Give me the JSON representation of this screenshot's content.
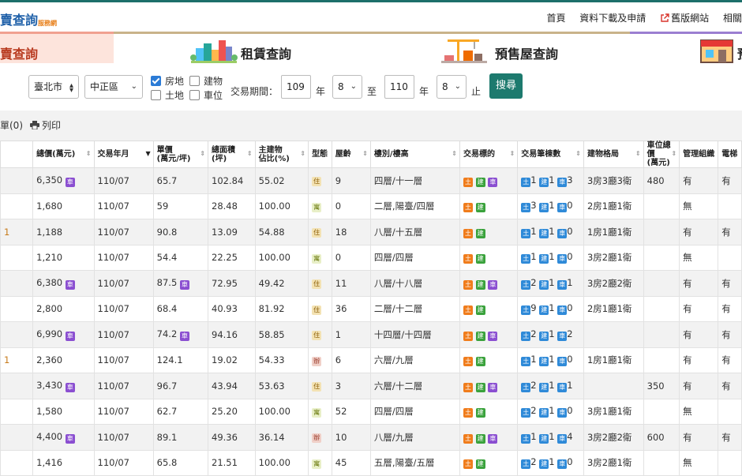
{
  "header": {
    "logo_part1": "賣查詢",
    "logo_part2": "服務網",
    "nav": [
      "首頁",
      "資料下載及申請",
      "舊版網站",
      "相關"
    ]
  },
  "tabs": [
    {
      "label": "賣查詢",
      "active": true
    },
    {
      "label": "租賃查詢",
      "active": false
    },
    {
      "label": "預售屋查詢",
      "active": false
    },
    {
      "label": "預",
      "active": false
    }
  ],
  "search": {
    "city": "臺北市",
    "district": "中正區",
    "checkboxes": [
      {
        "label": "房地",
        "checked": true
      },
      {
        "label": "建物",
        "checked": false
      },
      {
        "label": "土地",
        "checked": false
      },
      {
        "label": "車位",
        "checked": false
      }
    ],
    "period_label": "交易期間：",
    "start_year": "109",
    "year_unit": "年",
    "start_month": "8",
    "to_label": "至",
    "end_year": "110",
    "end_month": "8",
    "end_label": "止",
    "search_button": "搜尋"
  },
  "toolbar": {
    "list_label": "單(0)",
    "print_label": "列印"
  },
  "table": {
    "headers": [
      {
        "label": "",
        "sub": ""
      },
      {
        "label": "總價(萬元)",
        "sub": ""
      },
      {
        "label": "交易年月",
        "sub": ""
      },
      {
        "label": "單價",
        "sub": "(萬元/坪)"
      },
      {
        "label": "總面積",
        "sub": "(坪)"
      },
      {
        "label": "主建物",
        "sub": "佔比(%)"
      },
      {
        "label": "型態",
        "sub": ""
      },
      {
        "label": "屋齡",
        "sub": ""
      },
      {
        "label": "樓別/樓高",
        "sub": ""
      },
      {
        "label": "交易標的",
        "sub": ""
      },
      {
        "label": "交易筆棟數",
        "sub": ""
      },
      {
        "label": "建物格局",
        "sub": ""
      },
      {
        "label": "車位總價",
        "sub": "(萬元)"
      },
      {
        "label": "管理組織",
        "sub": ""
      },
      {
        "label": "電梯",
        "sub": ""
      }
    ],
    "badges": {
      "car": "車",
      "land": "土",
      "building": "建",
      "n_land": "土",
      "n_build": "建",
      "n_car": "車"
    },
    "rows": [
      {
        "lead": "",
        "price": "6,350",
        "car": true,
        "date": "110/07",
        "unit": "65.7",
        "unit_car": false,
        "area": "102.84",
        "ratio": "55.02",
        "type": "住",
        "type_class": "zhu",
        "age": "9",
        "floor": "四層/十一層",
        "target_car": true,
        "n": [
          "1",
          "1",
          "3"
        ],
        "layout": "3房3廳3衛",
        "park": "480",
        "mgmt": "有",
        "elev": "有"
      },
      {
        "lead": "",
        "price": "1,680",
        "car": false,
        "date": "110/07",
        "unit": "59",
        "unit_car": false,
        "area": "28.48",
        "ratio": "100.00",
        "type": "寓",
        "type_class": "zhai",
        "age": "0",
        "floor": "二層,陽臺/四層",
        "target_car": false,
        "n": [
          "3",
          "1",
          "0"
        ],
        "layout": "2房1廳1衛",
        "park": "",
        "mgmt": "無",
        "elev": ""
      },
      {
        "lead": "1",
        "price": "1,188",
        "car": false,
        "date": "110/07",
        "unit": "90.8",
        "unit_car": false,
        "area": "13.09",
        "ratio": "54.88",
        "type": "住",
        "type_class": "zhu",
        "age": "18",
        "floor": "八層/十五層",
        "target_car": false,
        "n": [
          "1",
          "1",
          "0"
        ],
        "layout": "1房1廳1衛",
        "park": "",
        "mgmt": "有",
        "elev": "有"
      },
      {
        "lead": "",
        "price": "1,210",
        "car": false,
        "date": "110/07",
        "unit": "54.4",
        "unit_car": false,
        "area": "22.25",
        "ratio": "100.00",
        "type": "寓",
        "type_class": "zhai",
        "age": "0",
        "floor": "四層/四層",
        "target_car": false,
        "n": [
          "1",
          "1",
          "0"
        ],
        "layout": "3房2廳1衛",
        "park": "",
        "mgmt": "無",
        "elev": ""
      },
      {
        "lead": "",
        "price": "6,380",
        "car": true,
        "date": "110/07",
        "unit": "87.5",
        "unit_car": true,
        "area": "72.95",
        "ratio": "49.42",
        "type": "住",
        "type_class": "zhu",
        "age": "11",
        "floor": "八層/十八層",
        "target_car": true,
        "n": [
          "2",
          "1",
          "1"
        ],
        "layout": "3房2廳2衛",
        "park": "",
        "mgmt": "有",
        "elev": "有"
      },
      {
        "lead": "",
        "price": "2,800",
        "car": false,
        "date": "110/07",
        "unit": "68.4",
        "unit_car": false,
        "area": "40.93",
        "ratio": "81.92",
        "type": "住",
        "type_class": "zhu",
        "age": "36",
        "floor": "二層/十二層",
        "target_car": false,
        "n": [
          "9",
          "1",
          "0"
        ],
        "layout": "2房1廳1衛",
        "park": "",
        "mgmt": "有",
        "elev": "有"
      },
      {
        "lead": "",
        "price": "6,990",
        "car": true,
        "date": "110/07",
        "unit": "74.2",
        "unit_car": true,
        "area": "94.16",
        "ratio": "58.85",
        "type": "住",
        "type_class": "zhu",
        "age": "1",
        "floor": "十四層/十四層",
        "target_car": true,
        "n": [
          "2",
          "1",
          "2"
        ],
        "layout": "",
        "park": "",
        "mgmt": "有",
        "elev": "有"
      },
      {
        "lead": "1",
        "price": "2,360",
        "car": false,
        "date": "110/07",
        "unit": "124.1",
        "unit_car": false,
        "area": "19.02",
        "ratio": "54.33",
        "type": "辦",
        "type_class": "ban",
        "age": "6",
        "floor": "六層/九層",
        "target_car": false,
        "n": [
          "1",
          "1",
          "0"
        ],
        "layout": "1房1廳1衛",
        "park": "",
        "mgmt": "有",
        "elev": "有"
      },
      {
        "lead": "",
        "price": "3,430",
        "car": true,
        "date": "110/07",
        "unit": "96.7",
        "unit_car": false,
        "area": "43.94",
        "ratio": "53.63",
        "type": "住",
        "type_class": "zhu",
        "age": "3",
        "floor": "六層/十二層",
        "target_car": true,
        "n": [
          "2",
          "1",
          "1"
        ],
        "layout": "",
        "park": "350",
        "mgmt": "有",
        "elev": "有"
      },
      {
        "lead": "",
        "price": "1,580",
        "car": false,
        "date": "110/07",
        "unit": "62.7",
        "unit_car": false,
        "area": "25.20",
        "ratio": "100.00",
        "type": "寓",
        "type_class": "zhai",
        "age": "52",
        "floor": "四層/四層",
        "target_car": false,
        "n": [
          "2",
          "1",
          "0"
        ],
        "layout": "3房1廳1衛",
        "park": "",
        "mgmt": "無",
        "elev": ""
      },
      {
        "lead": "",
        "price": "4,400",
        "car": true,
        "date": "110/07",
        "unit": "89.1",
        "unit_car": false,
        "area": "49.36",
        "ratio": "36.14",
        "type": "辦",
        "type_class": "ban",
        "age": "10",
        "floor": "八層/九層",
        "target_car": true,
        "n": [
          "1",
          "1",
          "4"
        ],
        "layout": "3房2廳2衛",
        "park": "600",
        "mgmt": "有",
        "elev": "有"
      },
      {
        "lead": "",
        "price": "1,416",
        "car": false,
        "date": "110/07",
        "unit": "65.8",
        "unit_car": false,
        "area": "21.51",
        "ratio": "100.00",
        "type": "寓",
        "type_class": "zhai",
        "age": "45",
        "floor": "五層,陽臺/五層",
        "target_car": false,
        "n": [
          "2",
          "1",
          "0"
        ],
        "layout": "3房2廳1衛",
        "park": "",
        "mgmt": "無",
        "elev": ""
      }
    ]
  }
}
